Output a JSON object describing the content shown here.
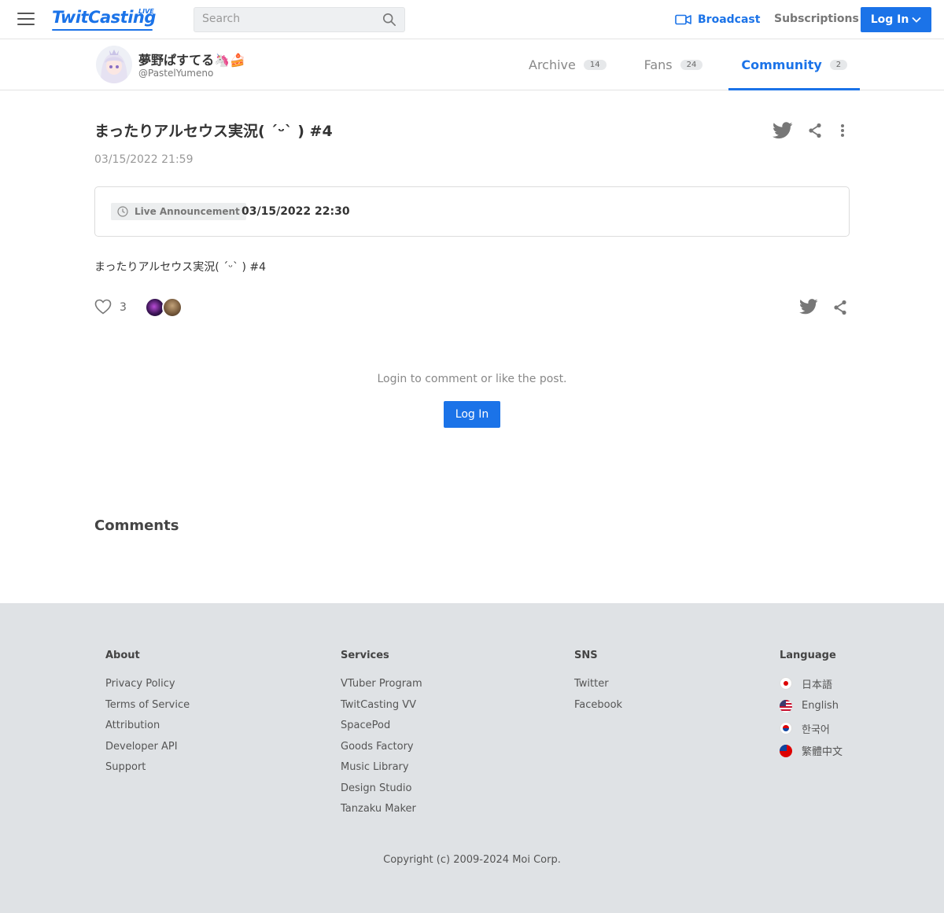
{
  "header": {
    "logo_text": "TwitCasting",
    "logo_live": "LIVE",
    "search_placeholder": "Search",
    "broadcast_label": "Broadcast",
    "subscriptions_label": "Subscriptions",
    "login_label": "Log In",
    "accent_color": "#1b73e8"
  },
  "profile": {
    "name": "夢野ぱすてる🦄🍰",
    "handle": "@PastelYumeno",
    "tabs": [
      {
        "label": "Archive",
        "count": "14",
        "active": false
      },
      {
        "label": "Fans",
        "count": "24",
        "active": false
      },
      {
        "label": "Community",
        "count": "2",
        "active": true
      }
    ]
  },
  "post": {
    "title": "まったりアルセウス実況( ˊᵕˋ ) #4",
    "date": "03/15/2022 21:59",
    "announcement_badge": "Live Announcement",
    "announcement_time": "03/15/2022 22:30",
    "body": "まったりアルセウス実況( ˊᵕˋ ) #4",
    "like_count": "3",
    "login_note": "Login to comment or like the post.",
    "login_button": "Log In",
    "comments_title": "Comments"
  },
  "footer": {
    "about": {
      "title": "About",
      "links": [
        "Privacy Policy",
        "Terms of Service",
        "Attribution",
        "Developer API",
        "Support"
      ]
    },
    "services": {
      "title": "Services",
      "links": [
        "VTuber Program",
        "TwitCasting VV",
        "SpacePod",
        "Goods Factory",
        "Music Library",
        "Design Studio",
        "Tanzaku Maker"
      ]
    },
    "sns": {
      "title": "SNS",
      "links": [
        "Twitter",
        "Facebook"
      ]
    },
    "language": {
      "title": "Language",
      "items": [
        "日本語",
        "English",
        "한국어",
        "繁體中文"
      ]
    },
    "copyright": "Copyright (c) 2009-2024 Moi Corp."
  }
}
